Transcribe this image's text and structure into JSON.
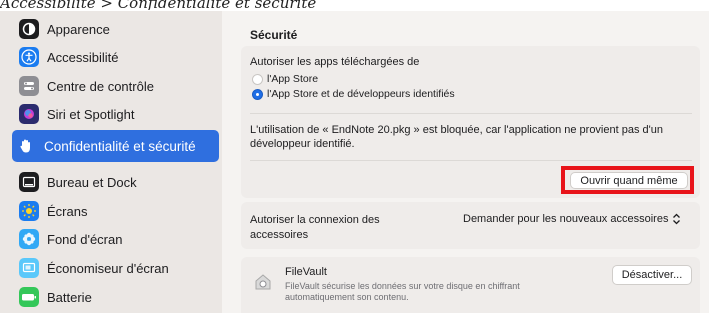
{
  "caption": "Accessibilité > Confidentialité et sécurité",
  "sidebar": {
    "items": [
      {
        "label": "Apparence",
        "icon": "appearance-icon",
        "color": "#1d1d1f"
      },
      {
        "label": "Accessibilité",
        "icon": "accessibility-icon",
        "color": "#1b7cf0"
      },
      {
        "label": "Centre de contrôle",
        "icon": "control-center-icon",
        "color": "#8e8e93"
      },
      {
        "label": "Siri et Spotlight",
        "icon": "siri-icon",
        "color": "#2b2b6e"
      },
      {
        "label": "Confidentialité et sécurité",
        "icon": "hand-icon",
        "color": "#2f6fdf",
        "selected": true
      },
      {
        "label": "Bureau et Dock",
        "icon": "dock-icon",
        "color": "#1d1d1f"
      },
      {
        "label": "Écrans",
        "icon": "displays-icon",
        "color": "#1b7cf0"
      },
      {
        "label": "Fond d'écran",
        "icon": "wallpaper-icon",
        "color": "#31a8f5"
      },
      {
        "label": "Économiseur d'écran",
        "icon": "screensaver-icon",
        "color": "#5ac8fa"
      },
      {
        "label": "Batterie",
        "icon": "battery-icon",
        "color": "#34c759"
      }
    ]
  },
  "main": {
    "section_title": "Sécurité",
    "allow_apps": {
      "label": "Autoriser les apps téléchargées de",
      "options": [
        {
          "label": "l'App Store",
          "selected": false
        },
        {
          "label": "l'App Store et de développeurs identifiés",
          "selected": true
        }
      ]
    },
    "blocked": {
      "line1": "L'utilisation de « EndNote 20.pkg » est bloquée, car l'application ne provient pas d'un",
      "line2": "développeur identifié.",
      "button": "Ouvrir quand même"
    },
    "accessories": {
      "label_line1": "Autoriser la connexion des",
      "label_line2": "accessoires",
      "value": "Demander pour les nouveaux accessoires",
      "chevron": "⌃⌄"
    },
    "filevault": {
      "title": "FileVault",
      "desc_line1": "FileVault sécurise les données sur votre disque en chiffrant",
      "desc_line2": "automatiquement son contenu.",
      "button": "Désactiver..."
    }
  },
  "colors": {
    "accent": "#2f6fdf",
    "highlight": "#e8141a"
  }
}
